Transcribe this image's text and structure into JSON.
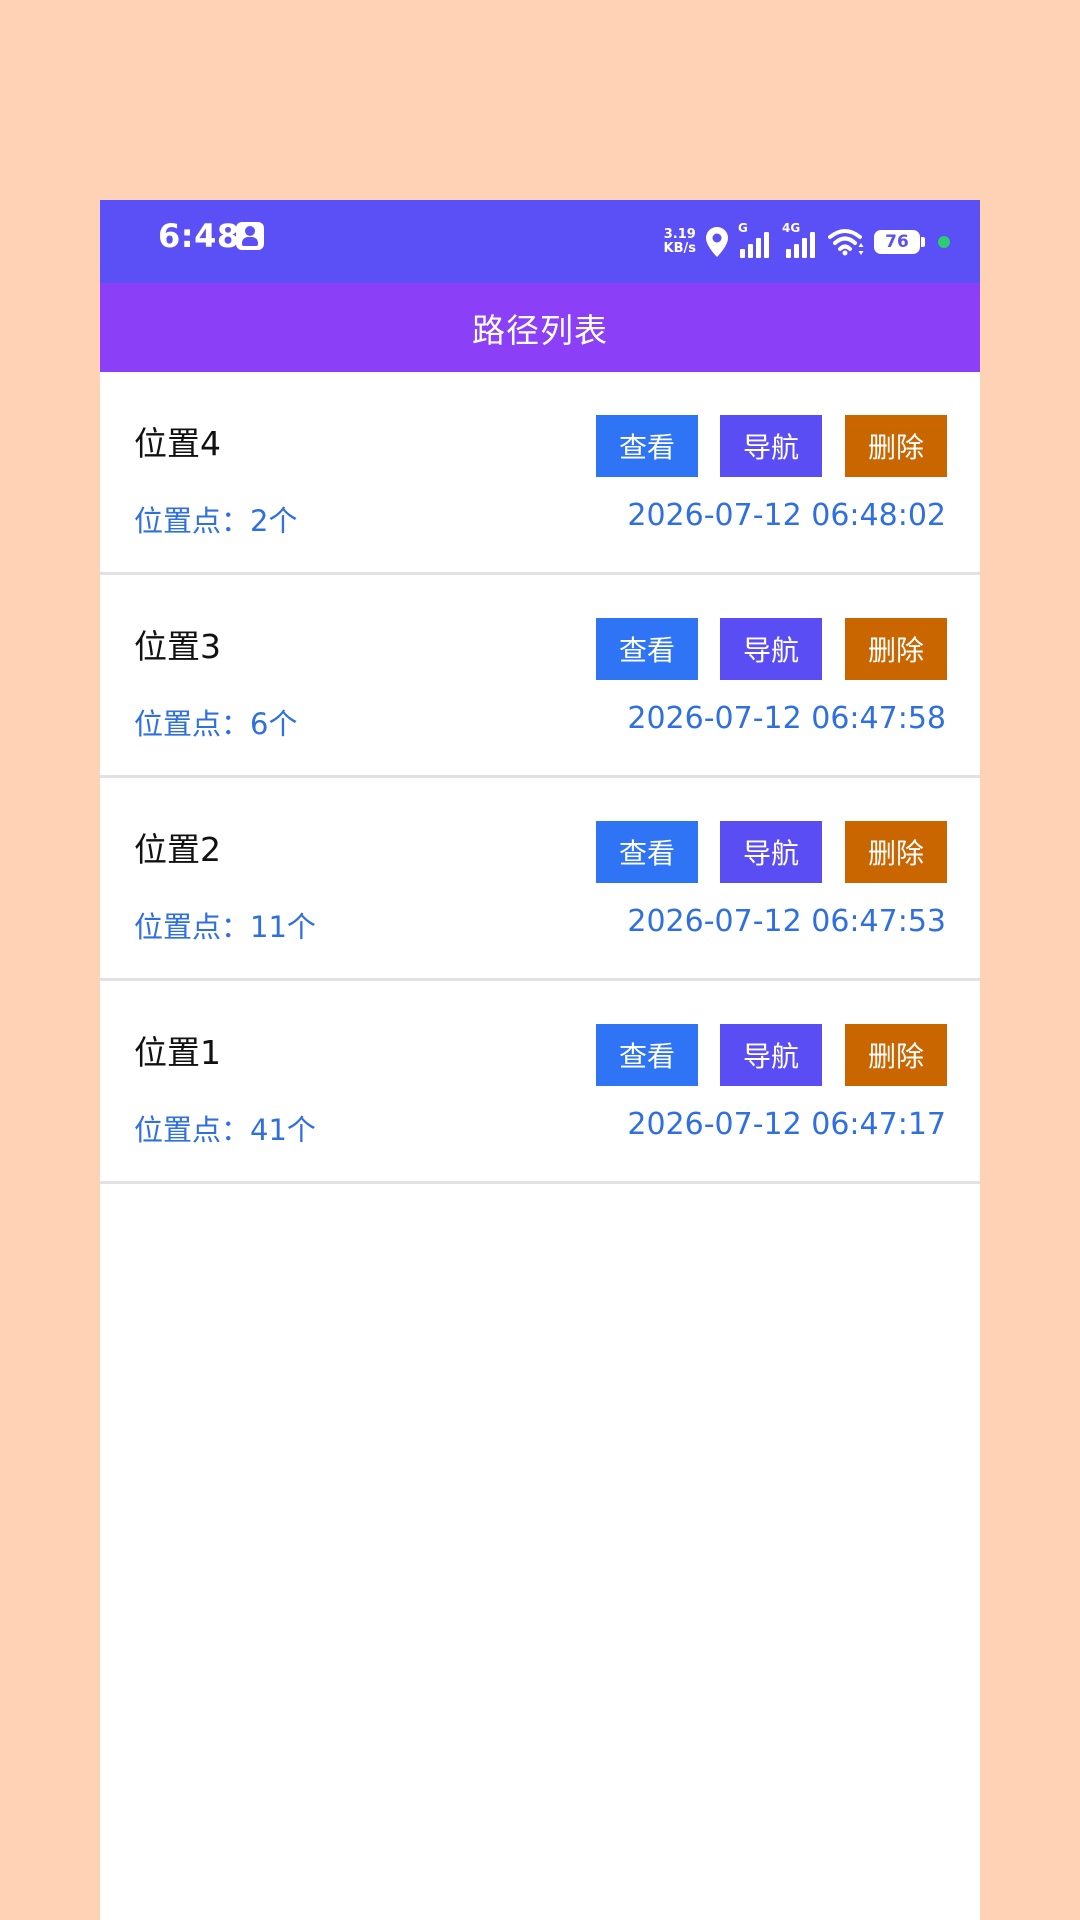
{
  "status_bar": {
    "time": "6:48",
    "net_speed_value": "3.19",
    "net_speed_unit": "KB/s",
    "sim1_label": "G",
    "sim2_label": "4G",
    "battery": "76",
    "colors": {
      "background": "#5A50F6"
    }
  },
  "app_bar": {
    "title": "路径列表",
    "color": "#8B3FF6"
  },
  "buttons": {
    "view": "查看",
    "navigate": "导航",
    "delete": "删除"
  },
  "routes": [
    {
      "name": "位置4",
      "points": "位置点：2个",
      "time": "2026-07-12 06:48:02"
    },
    {
      "name": "位置3",
      "points": "位置点：6个",
      "time": "2026-07-12 06:47:58"
    },
    {
      "name": "位置2",
      "points": "位置点：11个",
      "time": "2026-07-12 06:47:53"
    },
    {
      "name": "位置1",
      "points": "位置点：41个",
      "time": "2026-07-12 06:47:17"
    }
  ]
}
